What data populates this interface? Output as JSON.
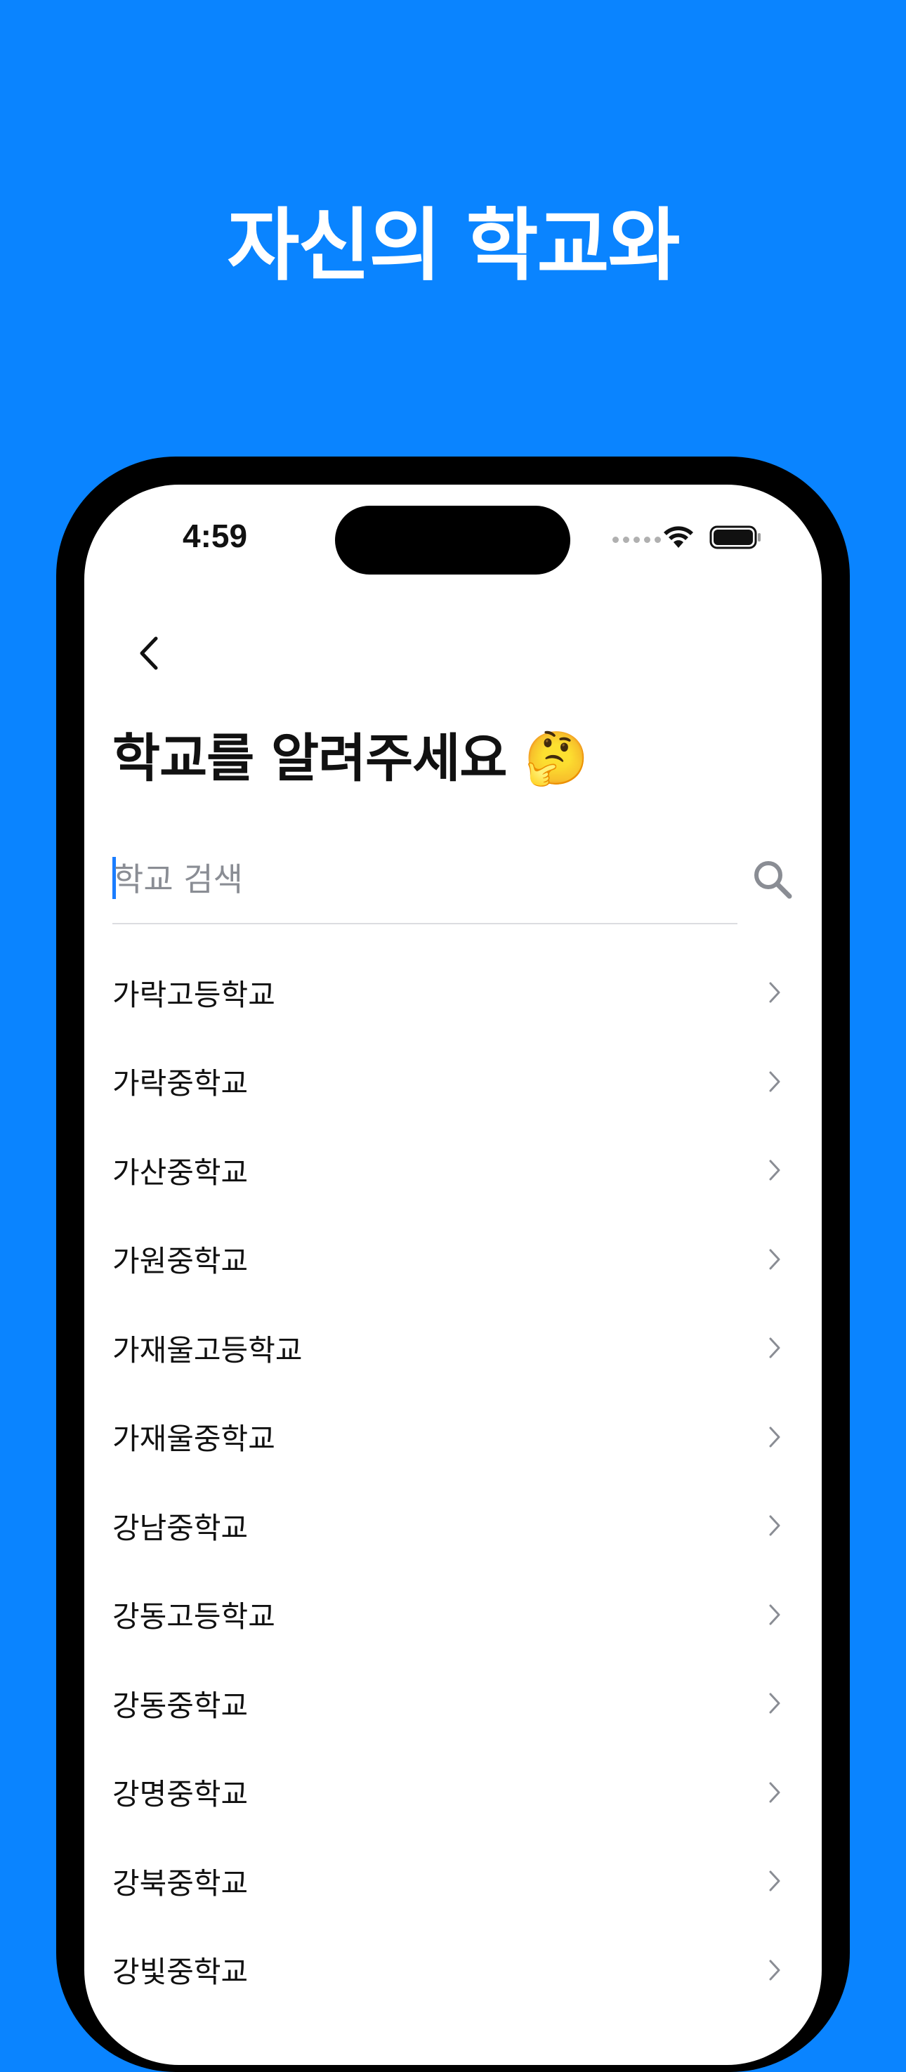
{
  "promo": {
    "headline": "자신의 학교와"
  },
  "status_bar": {
    "time": "4:59"
  },
  "page": {
    "title": "학교를 알려주세요 🤔"
  },
  "search": {
    "placeholder": "학교 검색",
    "value": ""
  },
  "schools": [
    "가락고등학교",
    "가락중학교",
    "가산중학교",
    "가원중학교",
    "가재울고등학교",
    "가재울중학교",
    "강남중학교",
    "강동고등학교",
    "강동중학교",
    "강명중학교",
    "강북중학교",
    "강빛중학교"
  ],
  "colors": {
    "background": "#0A84FF",
    "caret": "#1a7dff"
  }
}
